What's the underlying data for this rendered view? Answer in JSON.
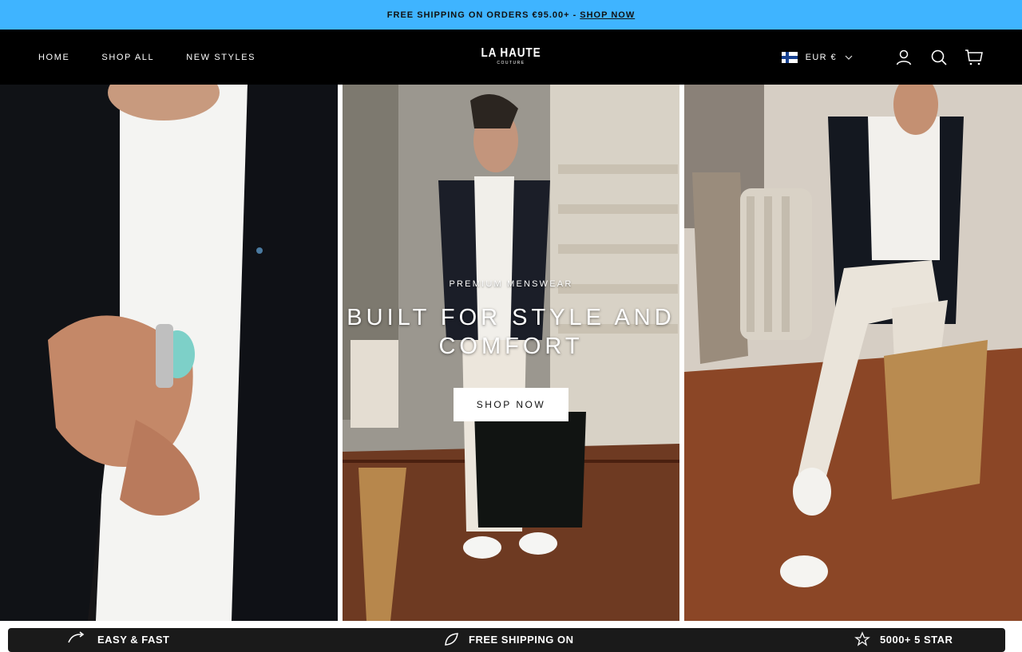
{
  "announcement": {
    "text": "FREE SHIPPING ON ORDERS €95.00+ -",
    "link": "SHOP NOW"
  },
  "nav": {
    "items": [
      "HOME",
      "SHOP ALL",
      "NEW STYLES"
    ]
  },
  "logo": {
    "line1": "LA HAUTE",
    "line2": "COUTURE"
  },
  "header": {
    "currency": "EUR €"
  },
  "hero": {
    "eyebrow": "PREMIUM MENSWEAR",
    "headline_line1": "BUILT FOR STYLE AND",
    "headline_line2": "COMFORT",
    "cta": "SHOP NOW",
    "panels": [
      "man-cuffing-sleeve-photo",
      "man-holding-tote-bag-photo",
      "man-seated-by-suitcase-photo"
    ]
  },
  "features": [
    "EASY & FAST",
    "FREE SHIPPING ON",
    "5000+ 5 STAR"
  ],
  "colors": {
    "announcement_bg": "#3fb4ff",
    "header_bg": "#000000"
  }
}
